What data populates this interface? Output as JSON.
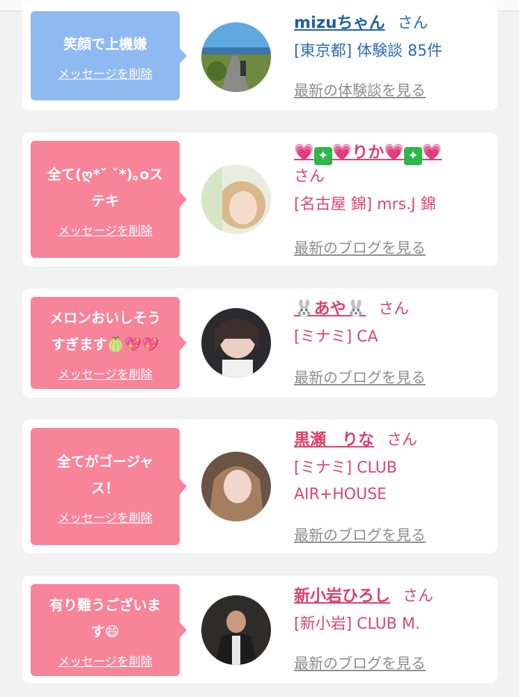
{
  "cards": [
    {
      "message": "笑顔で上機嫌",
      "delete_label": "メッセージを削除",
      "name": "mizuちゃん",
      "suffix": "さん",
      "shop": "[東京都] 体験談 85件",
      "latest_link": "最新の体験談を見る",
      "theme": "blue"
    },
    {
      "message": "全て(ღ*ˇ ˇ*)｡oス\nテキ",
      "delete_label": "メッセージを削除",
      "name_parts": [
        "💗",
        "✦",
        "💗",
        "りか",
        "💗",
        "✦",
        "💗"
      ],
      "suffix": "さん",
      "shop": "[名古屋 錦] mrs.J 錦",
      "latest_link": "最新のブログを見る",
      "theme": "pink"
    },
    {
      "message": "メロンおいしそう\nすぎます🍈💖💖",
      "delete_label": "メッセージを削除",
      "name_parts": [
        "🐰",
        "あや",
        "🐰"
      ],
      "suffix": "さん",
      "shop": "[ミナミ] CA",
      "latest_link": "最新のブログを見る",
      "theme": "pink"
    },
    {
      "message": "全てがゴージャ\nス！",
      "delete_label": "メッセージを削除",
      "name": "黒瀬　りな",
      "suffix": "さん",
      "shop": "[ミナミ] CLUB\nAIR+HOUSE",
      "latest_link": "最新のブログを見る",
      "theme": "pink"
    },
    {
      "message": "有り難うございま\nす😄",
      "delete_label": "メッセージを削除",
      "name": "新小岩ひろし",
      "suffix": "さん",
      "shop": "[新小岩] CLUB M.",
      "latest_link": "最新のブログを見る",
      "theme": "pink"
    }
  ],
  "colors": {
    "bubble_blue": "#8fb9f1",
    "bubble_pink": "#f8849a",
    "name_blue": "#1f5fa0",
    "name_pink": "#de3f6b",
    "link_gray": "#8d8d8d",
    "background": "#f2f2f2"
  }
}
